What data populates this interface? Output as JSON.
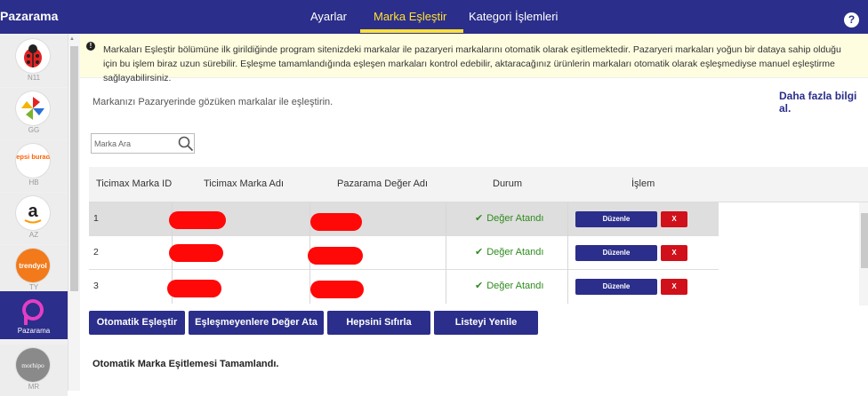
{
  "app": {
    "name": "Pazarama"
  },
  "nav": {
    "items": [
      "Ayarlar",
      "Marka Eşleştir",
      "Kategori İşlemleri"
    ],
    "active": "Marka Eşleştir",
    "help_label": "?"
  },
  "sidebar": {
    "items": [
      {
        "label": "N11",
        "icon": "n11-ladybug-logo"
      },
      {
        "label": "GG",
        "icon": "gittigidiyor-pinwheel-logo"
      },
      {
        "label": "HB",
        "icon": "hepsiburada-logo",
        "logo_text": "hepsi burada"
      },
      {
        "label": "AZ",
        "icon": "amazon-logo",
        "logo_text": "a"
      },
      {
        "label": "TY",
        "icon": "trendyol-logo",
        "logo_text": "trendyol"
      },
      {
        "label": "Pazarama",
        "icon": "pazarama-logo",
        "active": true
      },
      {
        "label": "MR",
        "icon": "morhipo-logo",
        "logo_text": "morhipo"
      }
    ]
  },
  "banner": {
    "icon": "exclamation-icon",
    "text": "Markaları Eşleştir bölümüne ilk girildiğinde program sitenizdeki markalar ile pazaryeri markalarını otomatik olarak eşitlemektedir. Pazaryeri markaları yoğun bir dataya sahip olduğu için bu işlem biraz uzun sürebilir. Eşleşme tamamlandığında eşleşen markaları kontrol edebilir, aktaracağınız ürünlerin markaları otomatik olarak eşleşmediyse manuel eşleştirme sağlayabilirsiniz."
  },
  "subtitle": "Markanızı Pazaryerinde gözüken markalar ile eşleştirin.",
  "more_info": "Daha fazla bilgi al.",
  "search": {
    "placeholder": "Marka Ara",
    "value": ""
  },
  "table": {
    "headers": [
      "Ticimax Marka ID",
      "Ticimax Marka Adı",
      "Pazarama Değer Adı",
      "Durum",
      "İşlem"
    ],
    "rows": [
      {
        "id": "1",
        "status": "Değer Atandı",
        "edit": "Düzenle",
        "delete": "X"
      },
      {
        "id": "2",
        "status": "Değer Atandı",
        "edit": "Düzenle",
        "delete": "X"
      },
      {
        "id": "3",
        "status": "Değer Atandı",
        "edit": "Düzenle",
        "delete": "X"
      }
    ]
  },
  "actions": [
    "Otomatik Eşleştir",
    "Eşleşmeyenlere Değer Ata",
    "Hepsini Sıfırla",
    "Listeyi Yenile"
  ],
  "completion_message": "Otomatik Marka Eşitlemesi Tamamlandı.",
  "colors": {
    "primary": "#2b2e8a",
    "active_tab": "#ffe033",
    "danger": "#d0101a",
    "success": "#2e8b1e",
    "redaction": "#ff0808",
    "banner_bg": "#fffde0"
  }
}
